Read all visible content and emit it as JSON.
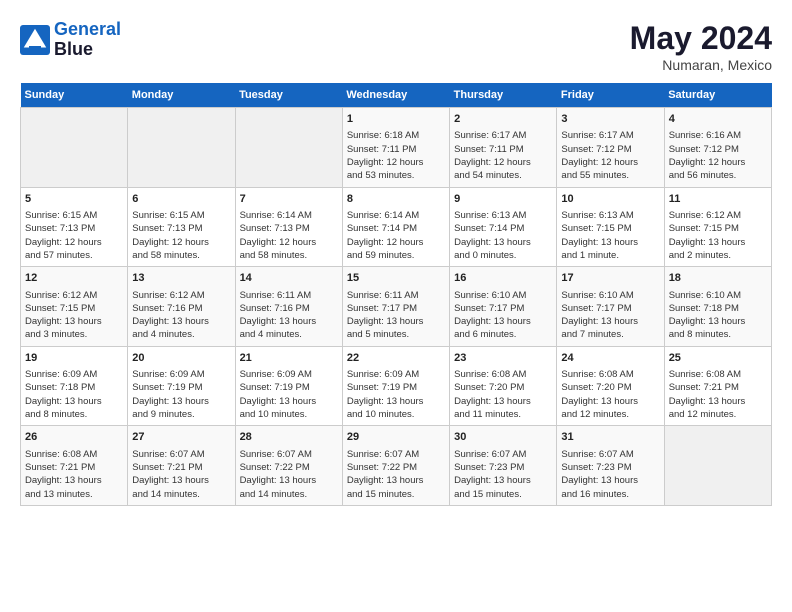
{
  "header": {
    "logo_line1": "General",
    "logo_line2": "Blue",
    "month": "May 2024",
    "location": "Numaran, Mexico"
  },
  "weekdays": [
    "Sunday",
    "Monday",
    "Tuesday",
    "Wednesday",
    "Thursday",
    "Friday",
    "Saturday"
  ],
  "weeks": [
    [
      {
        "day": "",
        "content": ""
      },
      {
        "day": "",
        "content": ""
      },
      {
        "day": "",
        "content": ""
      },
      {
        "day": "1",
        "content": "Sunrise: 6:18 AM\nSunset: 7:11 PM\nDaylight: 12 hours\nand 53 minutes."
      },
      {
        "day": "2",
        "content": "Sunrise: 6:17 AM\nSunset: 7:11 PM\nDaylight: 12 hours\nand 54 minutes."
      },
      {
        "day": "3",
        "content": "Sunrise: 6:17 AM\nSunset: 7:12 PM\nDaylight: 12 hours\nand 55 minutes."
      },
      {
        "day": "4",
        "content": "Sunrise: 6:16 AM\nSunset: 7:12 PM\nDaylight: 12 hours\nand 56 minutes."
      }
    ],
    [
      {
        "day": "5",
        "content": "Sunrise: 6:15 AM\nSunset: 7:13 PM\nDaylight: 12 hours\nand 57 minutes."
      },
      {
        "day": "6",
        "content": "Sunrise: 6:15 AM\nSunset: 7:13 PM\nDaylight: 12 hours\nand 58 minutes."
      },
      {
        "day": "7",
        "content": "Sunrise: 6:14 AM\nSunset: 7:13 PM\nDaylight: 12 hours\nand 58 minutes."
      },
      {
        "day": "8",
        "content": "Sunrise: 6:14 AM\nSunset: 7:14 PM\nDaylight: 12 hours\nand 59 minutes."
      },
      {
        "day": "9",
        "content": "Sunrise: 6:13 AM\nSunset: 7:14 PM\nDaylight: 13 hours\nand 0 minutes."
      },
      {
        "day": "10",
        "content": "Sunrise: 6:13 AM\nSunset: 7:15 PM\nDaylight: 13 hours\nand 1 minute."
      },
      {
        "day": "11",
        "content": "Sunrise: 6:12 AM\nSunset: 7:15 PM\nDaylight: 13 hours\nand 2 minutes."
      }
    ],
    [
      {
        "day": "12",
        "content": "Sunrise: 6:12 AM\nSunset: 7:15 PM\nDaylight: 13 hours\nand 3 minutes."
      },
      {
        "day": "13",
        "content": "Sunrise: 6:12 AM\nSunset: 7:16 PM\nDaylight: 13 hours\nand 4 minutes."
      },
      {
        "day": "14",
        "content": "Sunrise: 6:11 AM\nSunset: 7:16 PM\nDaylight: 13 hours\nand 4 minutes."
      },
      {
        "day": "15",
        "content": "Sunrise: 6:11 AM\nSunset: 7:17 PM\nDaylight: 13 hours\nand 5 minutes."
      },
      {
        "day": "16",
        "content": "Sunrise: 6:10 AM\nSunset: 7:17 PM\nDaylight: 13 hours\nand 6 minutes."
      },
      {
        "day": "17",
        "content": "Sunrise: 6:10 AM\nSunset: 7:17 PM\nDaylight: 13 hours\nand 7 minutes."
      },
      {
        "day": "18",
        "content": "Sunrise: 6:10 AM\nSunset: 7:18 PM\nDaylight: 13 hours\nand 8 minutes."
      }
    ],
    [
      {
        "day": "19",
        "content": "Sunrise: 6:09 AM\nSunset: 7:18 PM\nDaylight: 13 hours\nand 8 minutes."
      },
      {
        "day": "20",
        "content": "Sunrise: 6:09 AM\nSunset: 7:19 PM\nDaylight: 13 hours\nand 9 minutes."
      },
      {
        "day": "21",
        "content": "Sunrise: 6:09 AM\nSunset: 7:19 PM\nDaylight: 13 hours\nand 10 minutes."
      },
      {
        "day": "22",
        "content": "Sunrise: 6:09 AM\nSunset: 7:19 PM\nDaylight: 13 hours\nand 10 minutes."
      },
      {
        "day": "23",
        "content": "Sunrise: 6:08 AM\nSunset: 7:20 PM\nDaylight: 13 hours\nand 11 minutes."
      },
      {
        "day": "24",
        "content": "Sunrise: 6:08 AM\nSunset: 7:20 PM\nDaylight: 13 hours\nand 12 minutes."
      },
      {
        "day": "25",
        "content": "Sunrise: 6:08 AM\nSunset: 7:21 PM\nDaylight: 13 hours\nand 12 minutes."
      }
    ],
    [
      {
        "day": "26",
        "content": "Sunrise: 6:08 AM\nSunset: 7:21 PM\nDaylight: 13 hours\nand 13 minutes."
      },
      {
        "day": "27",
        "content": "Sunrise: 6:07 AM\nSunset: 7:21 PM\nDaylight: 13 hours\nand 14 minutes."
      },
      {
        "day": "28",
        "content": "Sunrise: 6:07 AM\nSunset: 7:22 PM\nDaylight: 13 hours\nand 14 minutes."
      },
      {
        "day": "29",
        "content": "Sunrise: 6:07 AM\nSunset: 7:22 PM\nDaylight: 13 hours\nand 15 minutes."
      },
      {
        "day": "30",
        "content": "Sunrise: 6:07 AM\nSunset: 7:23 PM\nDaylight: 13 hours\nand 15 minutes."
      },
      {
        "day": "31",
        "content": "Sunrise: 6:07 AM\nSunset: 7:23 PM\nDaylight: 13 hours\nand 16 minutes."
      },
      {
        "day": "",
        "content": ""
      }
    ]
  ]
}
